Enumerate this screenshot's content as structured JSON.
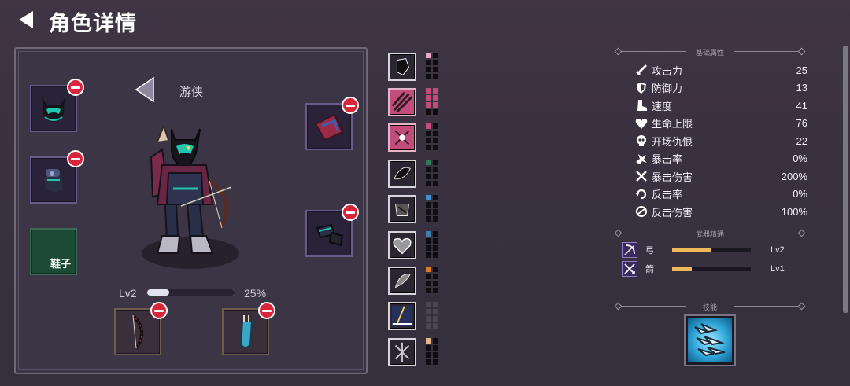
{
  "header": {
    "title": "角色详情"
  },
  "character": {
    "class_name": "游侠",
    "level_label": "Lv2",
    "xp_percent_label": "25%",
    "xp_fraction": 0.25
  },
  "equipment": {
    "empty_slot_label": "鞋子"
  },
  "sections": {
    "base_attributes": "基础属性",
    "weapon_mastery": "武器精通",
    "skills": "技能"
  },
  "stats": [
    {
      "icon": "sword-icon",
      "name": "攻击力",
      "value": "25"
    },
    {
      "icon": "shield-icon",
      "name": "防御力",
      "value": "13"
    },
    {
      "icon": "boot-icon",
      "name": "速度",
      "value": "41"
    },
    {
      "icon": "heart-icon",
      "name": "生命上限",
      "value": "76"
    },
    {
      "icon": "skull-icon",
      "name": "开场仇恨",
      "value": "22"
    },
    {
      "icon": "burst-icon",
      "name": "暴击率",
      "value": "0%"
    },
    {
      "icon": "crossed-swords-icon",
      "name": "暴击伤害",
      "value": "200%"
    },
    {
      "icon": "counter-icon",
      "name": "反击率",
      "value": "0%"
    },
    {
      "icon": "counter-damage-icon",
      "name": "反击伤害",
      "value": "100%"
    }
  ],
  "mastery": [
    {
      "icon": "bow-icon",
      "name": "弓",
      "level": "Lv2",
      "fraction": 0.5
    },
    {
      "icon": "arrow-icon",
      "name": "箭",
      "level": "Lv1",
      "fraction": 0.25
    }
  ],
  "runes": [
    {
      "style": "gray",
      "pips": [
        "#f2a6c8",
        "#0f0d12",
        "#0f0d12",
        "#0f0d12",
        "#0f0d12",
        "#0f0d12",
        "#0f0d12",
        "#0f0d12"
      ]
    },
    {
      "style": "pink",
      "pips": [
        "#c24d7c",
        "#c24d7c",
        "#c24d7c",
        "#c24d7c",
        "#c24d7c",
        "#c24d7c",
        "#0f0d12",
        "#0f0d12"
      ]
    },
    {
      "style": "pink",
      "pips": [
        "#c24d7c",
        "#0f0d12",
        "#0f0d12",
        "#0f0d12",
        "#0f0d12",
        "#0f0d12",
        "#0f0d12",
        "#0f0d12"
      ]
    },
    {
      "style": "gray",
      "pips": [
        "#2f7a5a",
        "#0f0d12",
        "#0f0d12",
        "#0f0d12",
        "#0f0d12",
        "#0f0d12",
        "#0f0d12",
        "#0f0d12"
      ]
    },
    {
      "style": "gray",
      "pips": [
        "#3e8fd0",
        "#0f0d12",
        "#0f0d12",
        "#0f0d12",
        "#0f0d12",
        "#0f0d12",
        "#0f0d12",
        "#0f0d12"
      ]
    },
    {
      "style": "gray",
      "pips": [
        "#3e7fb0",
        "#0f0d12",
        "#0f0d12",
        "#0f0d12",
        "#0f0d12",
        "#0f0d12",
        "#0f0d12",
        "#0f0d12"
      ]
    },
    {
      "style": "gray",
      "pips": [
        "#e07a2a",
        "#0f0d12",
        "#0f0d12",
        "#0f0d12",
        "#0f0d12",
        "#0f0d12",
        "#0f0d12",
        "#0f0d12"
      ]
    },
    {
      "style": "dim",
      "pips": [
        "#4a4752",
        "#4a4752",
        "#4a4752",
        "#4a4752",
        "#4a4752",
        "#4a4752",
        "#4a4752",
        "#4a4752"
      ]
    },
    {
      "style": "gray",
      "pips": [
        "#e8b48a",
        "#0f0d12",
        "#0f0d12",
        "#0f0d12",
        "#0f0d12",
        "#0f0d12",
        "#0f0d12",
        "#0f0d12"
      ]
    }
  ]
}
